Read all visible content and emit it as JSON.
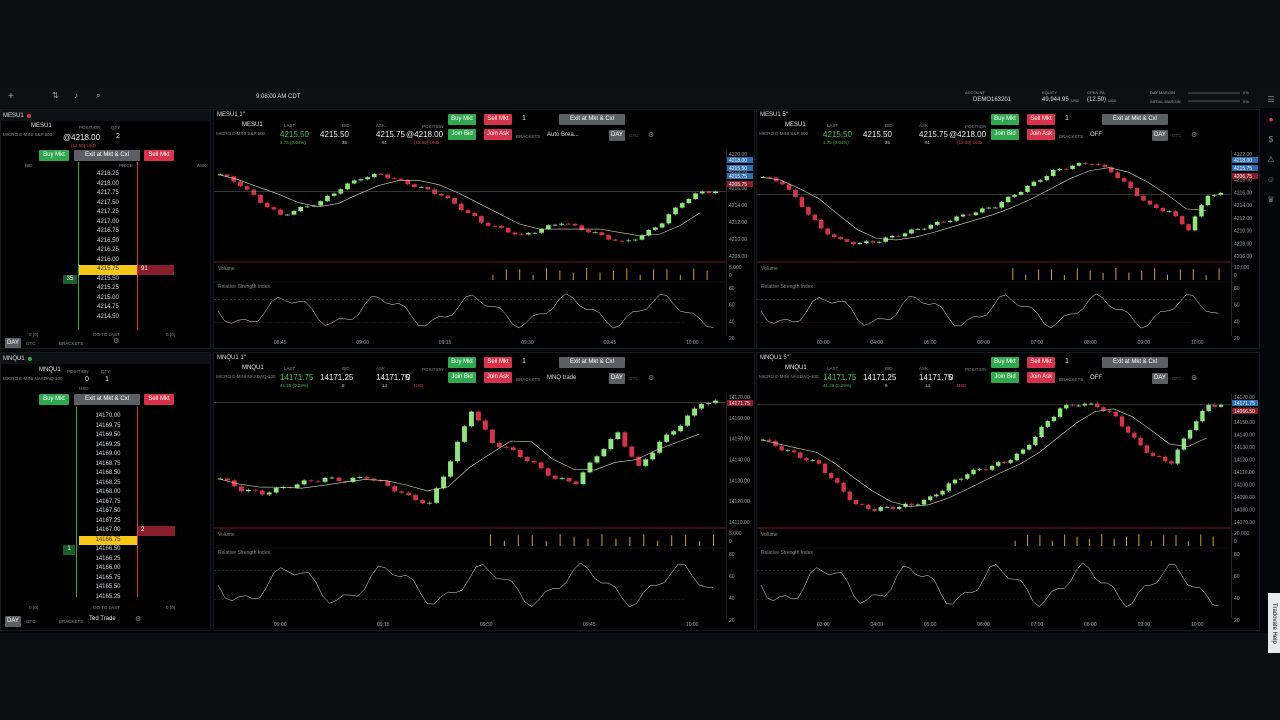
{
  "top": {
    "time": "9:08:00 AM CDT",
    "account_label": "ACCOUNT",
    "account": "DEMO163201",
    "equity_label": "EQUITY",
    "equity": "49,944.95",
    "equity_unit": "USD",
    "open_pl_label": "OPEN P/L",
    "open_pl": "(12.50)",
    "open_pl_unit": "USD",
    "day_margin_label": "DAY MARGIN",
    "initial_margin_label": "INITIAL MARGIN",
    "day_margin_pct": "0%",
    "initial_margin_pct": "0%"
  },
  "dom1": {
    "title": "MESU1",
    "desc": "MICRO E-MINI S&P 500",
    "position_label": "POSITION",
    "qty_label": "QTY",
    "price": "@4218.00",
    "qty": "2",
    "pl": "(12.50) USD",
    "buy": "Buy Mkt",
    "exit": "Exit at Mkt & Cxl",
    "sell": "Sell Mkt",
    "bid_hdr": "BID",
    "price_hdr": "PRICE",
    "ask_hdr": "ASK",
    "rows": [
      "4218.25",
      "4218.00",
      "4217.75",
      "4217.50",
      "4217.25",
      "4217.00",
      "4216.75",
      "4216.50",
      "4216.25",
      "4216.00",
      "4215.75",
      "4215.50",
      "4215.25",
      "4215.00",
      "4214.75",
      "4214.50"
    ],
    "hl_price": "4215.75",
    "hl_ask": "91",
    "bid_size": "35",
    "foot_left": "0 (0)",
    "foot_mid": "GO TO LAST",
    "foot_right": "0 (0)",
    "footer_left": "(0)",
    "footer_right": "(0)",
    "day": "DAY",
    "gtc": "GTC",
    "brackets": "BRACKETS"
  },
  "dom2": {
    "title": "MNQU1",
    "desc": "MICRO E-MINI NASDAQ-100",
    "position_label": "POSITION",
    "qty_label": "QTY",
    "pos": "0",
    "qty": "1",
    "unit": "USD",
    "buy": "Buy Mkt",
    "exit": "Exit at Mkt & Cxl",
    "sell": "Sell Mkt",
    "rows": [
      "14170.00",
      "14169.75",
      "14169.50",
      "14169.25",
      "14169.00",
      "14168.75",
      "14168.50",
      "14168.25",
      "14168.00",
      "14167.75",
      "14167.50",
      "14167.25",
      "14167.00",
      "14166.75",
      "14166.50",
      "14166.25",
      "14166.00",
      "14165.75",
      "14165.50",
      "14165.25"
    ],
    "ask_size": "2",
    "bid_size": "1",
    "foot_left": "0 (0)",
    "foot_mid": "GO TO LAST",
    "foot_right": "0 (0)",
    "day": "DAY",
    "gtc": "GTC",
    "brackets": "BRACKETS",
    "bracket_value": "Ted Trade"
  },
  "ch1": {
    "tab": "MESU1 1ʹʹ",
    "symbol": "MESU1",
    "desc": "MICRO E-MINI S&P 500",
    "last_label": "LAST",
    "bid_label": "BID",
    "ask_label": "ASK",
    "last": "4215.50",
    "change": "1.75 (0.04%)",
    "bid": "4215.50",
    "bid_size": "35",
    "ask": "4215.75",
    "ask_size": "91",
    "position_label": "POSITION",
    "pos": "@4218.00",
    "pl": "(12.50) USD",
    "qty": "1",
    "buy": "Buy Mkt",
    "sell": "Sell Mkt",
    "exit": "Exit at Mkt & Cxl",
    "join_bid": "Join Bid",
    "join_ask": "Join Ask",
    "brackets": "BRACKETS",
    "bracket_value": "Auto Brea...",
    "day": "DAY",
    "gtc": "GTC",
    "volume": "Volume",
    "rsi": "Relative Strength Index",
    "y_ticks": [
      "4220.00",
      "4218.00",
      "4216.00",
      "4214.00",
      "4212.00",
      "4210.00",
      "4208.00"
    ],
    "price_tags": [
      "4218.00",
      "4215.50",
      "4215.75",
      "4205.75"
    ],
    "vol_ticks": [
      "5,000",
      "0"
    ],
    "rsi_ticks": [
      "80",
      "60",
      "40",
      "20"
    ],
    "x_ticks": [
      "08:45",
      "09:00",
      "09:15",
      "09:30",
      "09:45",
      "10:00"
    ]
  },
  "ch2": {
    "tab": "MESU1 5ʹʹ",
    "symbol": "MESU1",
    "desc": "MICRO E-MINI S&P 500",
    "last_label": "LAST",
    "bid_label": "BID",
    "ask_label": "ASK",
    "last": "4215.50",
    "change": "1.75 (0.04%)",
    "bid": "4215.50",
    "bid_size": "35",
    "ask": "4215.75",
    "ask_size": "91",
    "position_label": "POSITION",
    "pos": "@4218.00",
    "pl": "(12.50) USD",
    "qty": "1",
    "buy": "Buy Mkt",
    "sell": "Sell Mkt",
    "exit": "Exit at Mkt & Cxl",
    "join_bid": "Join Bid",
    "join_ask": "Join Ask",
    "brackets": "BRACKETS",
    "bracket_value": "OFF",
    "day": "DAY",
    "gtc": "GTC",
    "volume": "Volume",
    "rsi": "Relative Strength Index",
    "y_ticks": [
      "4222.00",
      "4220.00",
      "4218.00",
      "4216.00",
      "4214.00",
      "4212.00",
      "4210.00",
      "4208.00",
      "4206.00"
    ],
    "price_tags": [
      "4218.00",
      "4215.75",
      "4206.75"
    ],
    "vol_ticks": [
      "10,000",
      "0"
    ],
    "rsi_ticks": [
      "80",
      "60",
      "40",
      "20"
    ],
    "x_ticks": [
      "03:00",
      "04:00",
      "05:00",
      "06:00",
      "07:00",
      "08:00",
      "09:00",
      "10:00"
    ]
  },
  "ch3": {
    "tab": "MNQU1 1ʹʹ",
    "symbol": "MNQU1",
    "desc": "MICRO E-MINI NASDAQ-100",
    "last_label": "LAST",
    "bid_label": "BID",
    "ask_label": "ASK",
    "last": "14171.75",
    "change": "41.25 (0.29%)",
    "bid": "14171.25",
    "bid_size": "9",
    "ask": "14171.75",
    "ask_size": "14",
    "position_label": "POSITION",
    "pos": "0",
    "pl": "USD",
    "qty": "1",
    "buy": "Buy Mkt",
    "sell": "Sell Mkt",
    "exit": "Exit at Mkt & Cxl",
    "join_bid": "Join Bid",
    "join_ask": "Join Ask",
    "brackets": "BRACKETS",
    "bracket_value": "MNQ trade",
    "day": "DAY",
    "gtc": "GTC",
    "volume": "Volume",
    "rsi": "Relative Strength Index",
    "y_ticks": [
      "14170.00",
      "14160.00",
      "14150.00",
      "14140.00",
      "14130.00",
      "14120.00",
      "14110.00"
    ],
    "price_tags": [
      "14171.75"
    ],
    "vol_ticks": [
      "5,000",
      "0"
    ],
    "rsi_ticks": [
      "80",
      "60",
      "40",
      "20"
    ],
    "x_ticks": [
      "09:00",
      "09:15",
      "09:30",
      "09:45",
      "10:00"
    ]
  },
  "ch4": {
    "tab": "MNQU1 5ʹʹ",
    "symbol": "MNQU1",
    "desc": "MICRO E-MINI NASDAQ-100",
    "last_label": "LAST",
    "bid_label": "BID",
    "ask_label": "ASK",
    "last": "14171.75",
    "change": "41.25 (0.29%)",
    "bid": "14171.25",
    "bid_size": "9",
    "ask": "14171.75",
    "ask_size": "14",
    "position_label": "POSITION",
    "pos": "0",
    "pl": "USD",
    "qty": "1",
    "buy": "Buy Mkt",
    "sell": "Sell Mkt",
    "exit": "Exit at Mkt & Cxl",
    "join_bid": "Join Bid",
    "join_ask": "Join Ask",
    "brackets": "BRACKETS",
    "bracket_value": "OFF",
    "day": "DAY",
    "gtc": "GTC",
    "volume": "Volume",
    "rsi": "Relative Strength Index",
    "y_ticks": [
      "14170.00",
      "14160.00",
      "14150.00",
      "14140.00",
      "14130.00",
      "14120.00",
      "14110.00",
      "14100.00",
      "14090.00",
      "14080.00",
      "14070.00"
    ],
    "price_tags": [
      "14171.75",
      "14066.50"
    ],
    "vol_ticks": [
      "20,000",
      "0"
    ],
    "rsi_ticks": [
      "80",
      "60",
      "40",
      "20"
    ],
    "x_ticks": [
      "03:00",
      "04:00",
      "05:00",
      "06:00",
      "07:00",
      "08:00",
      "09:00",
      "10:00"
    ]
  },
  "help": "Tradovate Help",
  "colors": {
    "up": "#8ee77a",
    "down": "#d8324a",
    "buy": "#2fa84f",
    "sell": "#d8324a",
    "bg": "#000000"
  },
  "chart_data": [
    {
      "type": "line",
      "title": "MESU1 1ʹʹ",
      "x_ticks": [
        "08:45",
        "09:00",
        "09:15",
        "09:30",
        "09:45",
        "10:00"
      ],
      "ylim": [
        4205.75,
        4221
      ],
      "series": [
        {
          "values": [
            4218,
            4216.5,
            4214,
            4212,
            4213,
            4214,
            4216,
            4217.5,
            4218,
            4217,
            4216,
            4215,
            4213,
            4211,
            4210,
            4209,
            4210,
            4211,
            4210,
            4209,
            4208,
            4209,
            4211,
            4214,
            4215.5
          ]
        }
      ]
    },
    {
      "type": "line",
      "title": "MESU1 5ʹʹ",
      "x_ticks": [
        "03:00",
        "04:00",
        "05:00",
        "06:00",
        "07:00",
        "08:00",
        "09:00",
        "10:00"
      ],
      "ylim": [
        4205,
        4223
      ],
      "series": [
        {
          "values": [
            4219,
            4218,
            4214,
            4210,
            4208,
            4207.5,
            4208,
            4209,
            4210,
            4211,
            4212,
            4213,
            4214,
            4216,
            4218,
            4220,
            4221,
            4221.5,
            4220,
            4217,
            4214,
            4213,
            4210,
            4216
          ]
        }
      ]
    },
    {
      "type": "line",
      "title": "MNQU1 1ʹʹ",
      "x_ticks": [
        "09:00",
        "09:15",
        "09:30",
        "09:45",
        "10:00"
      ],
      "ylim": [
        14105,
        14175
      ],
      "series": [
        {
          "values": [
            14130,
            14124,
            14122,
            14125,
            14128,
            14130,
            14129,
            14131,
            14126,
            14120,
            14116,
            14140,
            14168,
            14150,
            14145,
            14138,
            14130,
            14128,
            14143,
            14155,
            14136,
            14150,
            14160,
            14172
          ]
        }
      ]
    },
    {
      "type": "line",
      "title": "MNQU1 5ʹʹ",
      "x_ticks": [
        "03:00",
        "04:00",
        "05:00",
        "06:00",
        "07:00",
        "08:00",
        "09:00",
        "10:00"
      ],
      "ylim": [
        14065,
        14178
      ],
      "series": [
        {
          "values": [
            14140,
            14132,
            14125,
            14118,
            14100,
            14082,
            14078,
            14080,
            14082,
            14088,
            14100,
            14110,
            14115,
            14120,
            14130,
            14150,
            14168,
            14172,
            14170,
            14160,
            14140,
            14125,
            14120,
            14150,
            14171
          ]
        }
      ]
    }
  ]
}
